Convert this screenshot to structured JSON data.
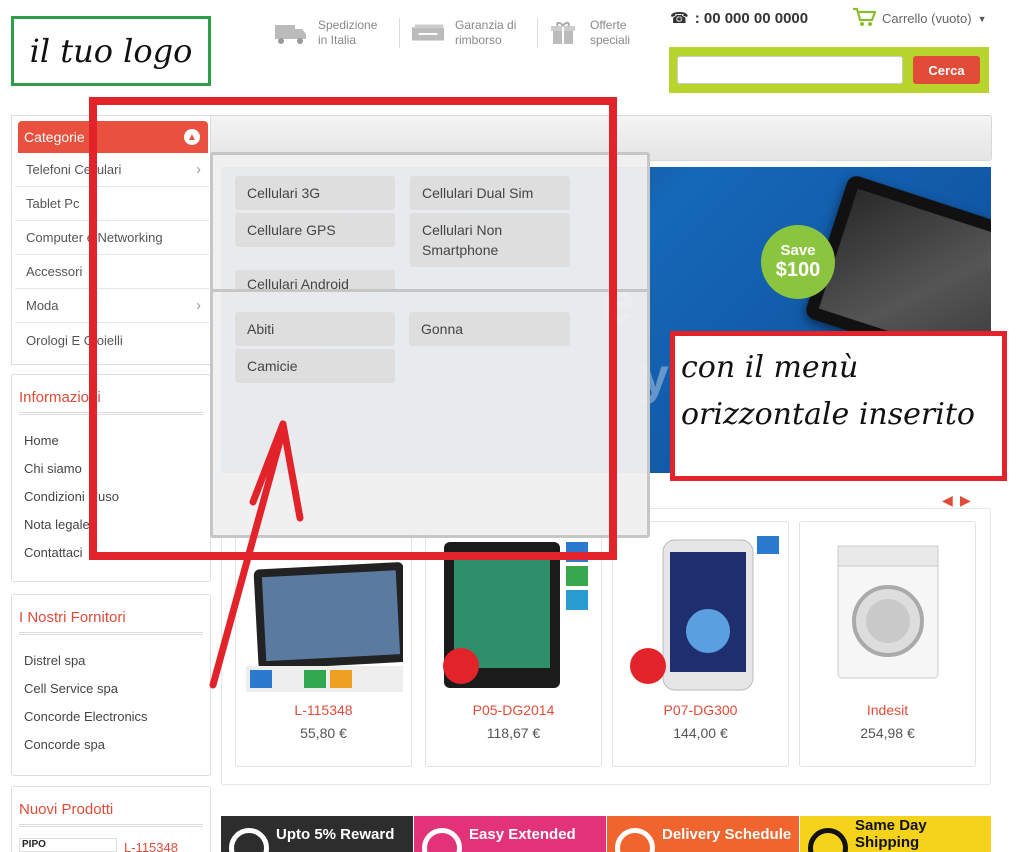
{
  "header": {
    "logo_text": "il tuo logo",
    "features": [
      {
        "icon": "truck-icon",
        "label": "Spedizione\nin Italia"
      },
      {
        "icon": "money-icon",
        "label": "Garanzia di\nrimborso"
      },
      {
        "icon": "gift-icon",
        "label": "Offerte\nspeciali"
      }
    ],
    "phone": ": 00 000 00 0000",
    "cart_label": "Carrello (vuoto)",
    "search_placeholder": "",
    "search_button": "Cerca"
  },
  "categories": {
    "title": "Categorie",
    "items": [
      {
        "label": "Telefoni Cellulari",
        "has_arrow": true
      },
      {
        "label": "Tablet Pc",
        "has_arrow": false
      },
      {
        "label": "Computer e Networking",
        "has_arrow": false
      },
      {
        "label": "Accessori",
        "has_arrow": false
      },
      {
        "label": "Moda",
        "has_arrow": true
      },
      {
        "label": "Orologi E Gioielli",
        "has_arrow": false
      }
    ]
  },
  "mega_menu": {
    "group1": [
      "Cellulari 3G",
      "Cellulari Dual Sim",
      "Cellulare GPS",
      "Cellulari Non Smartphone",
      "Cellulari Android"
    ],
    "group2": [
      "Abiti",
      "Gonna",
      "Camicie"
    ]
  },
  "info_block": {
    "title": "Informazioni",
    "links": [
      "Home",
      "Chi siamo",
      "Condizioni d'uso",
      "Nota legale",
      "Contattaci"
    ]
  },
  "suppliers_block": {
    "title": "I Nostri Fornitori",
    "links": [
      "Distrel spa",
      "Cell Service spa",
      "Concorde Electronics",
      "Concorde spa"
    ]
  },
  "new_products_block": {
    "title": "Nuovi Prodotti",
    "thumb_text": "PIPO",
    "first_link": "L-115348"
  },
  "banner": {
    "save_label": "Save",
    "save_amount": "$100"
  },
  "products": [
    {
      "name": "L-115348",
      "price": "55,80 €"
    },
    {
      "name": "P05-DG2014",
      "price": "118,67 €"
    },
    {
      "name": "P07-DG300",
      "price": "144,00 €"
    },
    {
      "name": "Indesit",
      "price": "254,98 €"
    }
  ],
  "promo_strip": [
    {
      "label": "Upto 5% Reward",
      "color": "#2d2d2d"
    },
    {
      "label": "Easy Extended",
      "color": "#e2337a"
    },
    {
      "label": "Delivery Schedule",
      "color": "#f0642d"
    },
    {
      "label": "Same Day Shipping",
      "color": "#f5d31a"
    }
  ],
  "annotation": {
    "line1": "con il menù",
    "line2": "orizzontale inserito"
  },
  "colors": {
    "accent": "#e04c38",
    "search_bar": "#b7d52b",
    "annotation_red": "#e2232a",
    "logo_border": "#2e9e4c"
  }
}
